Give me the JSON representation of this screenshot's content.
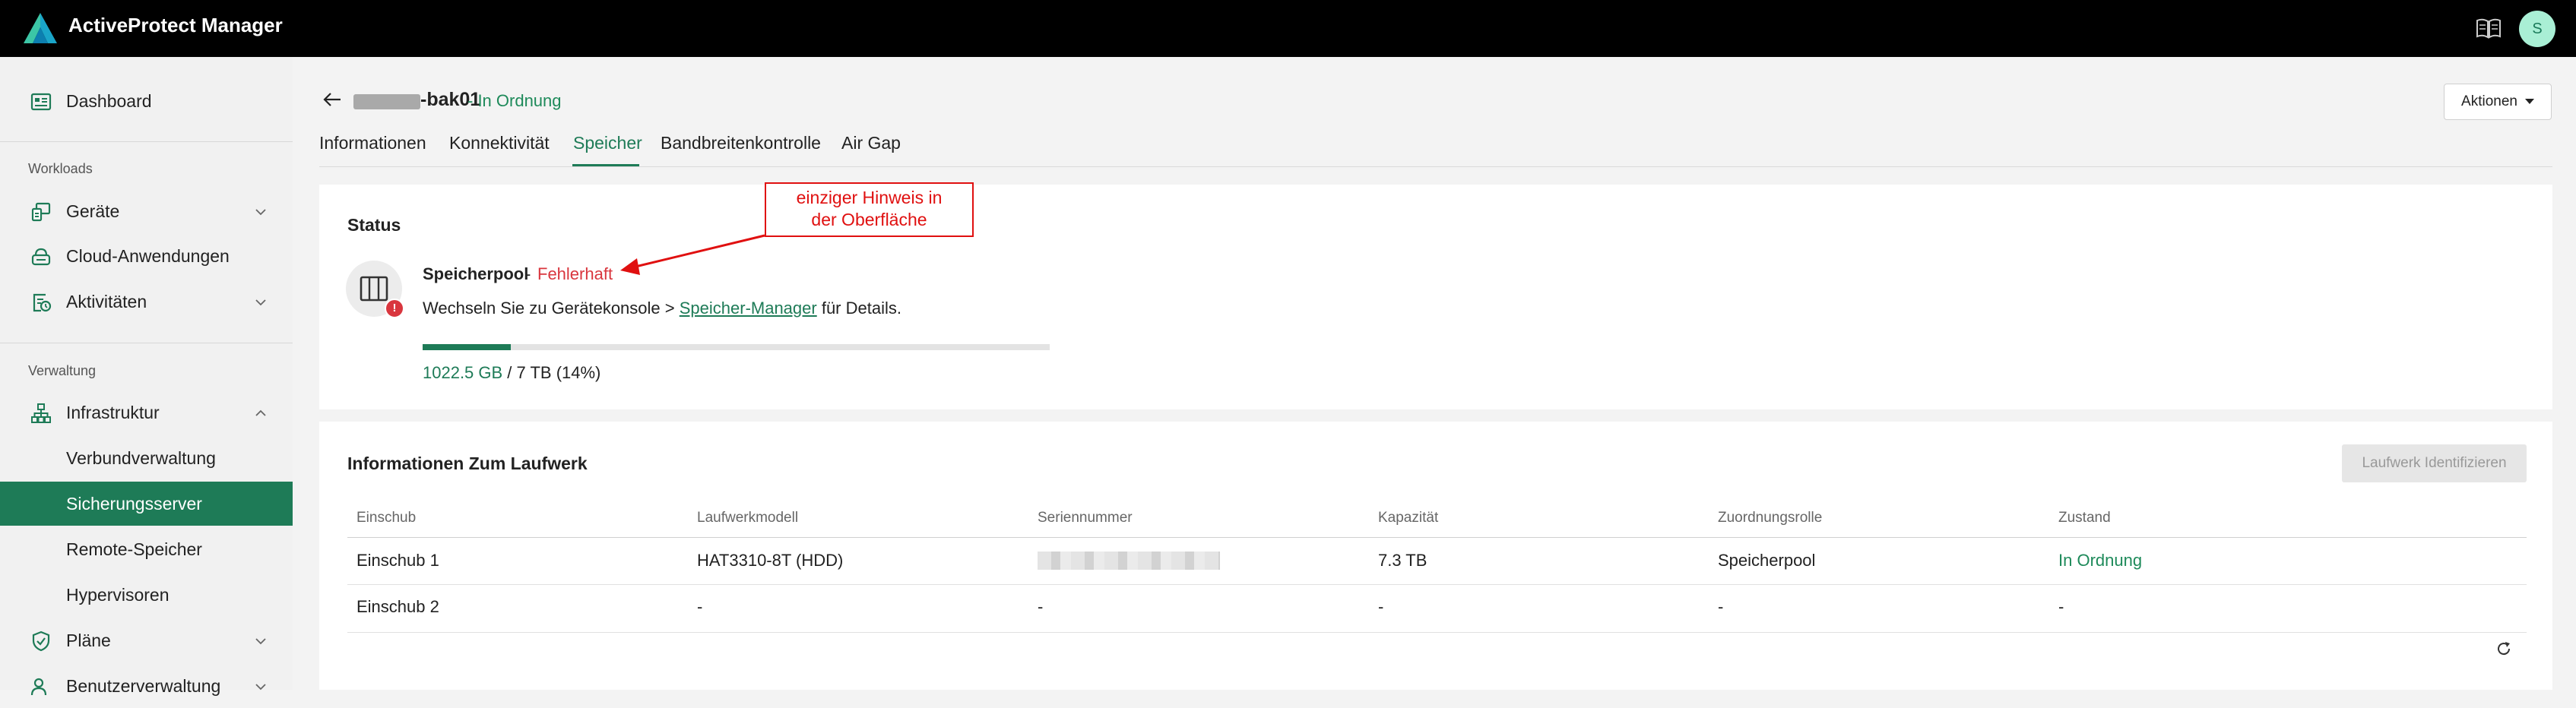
{
  "app": {
    "title": "ActiveProtect Manager",
    "avatar_initial": "S",
    "brand_color": "#1e7b57"
  },
  "sidebar": {
    "dashboard": "Dashboard",
    "section_workloads": "Workloads",
    "workloads": [
      "Geräte",
      "Cloud-Anwendungen",
      "Aktivitäten"
    ],
    "section_admin": "Verwaltung",
    "infrastructure": "Infrastruktur",
    "infrastructure_items": [
      "Verbundverwaltung",
      "Sicherungsserver",
      "Remote-Speicher",
      "Hypervisoren"
    ],
    "active_item": "Sicherungsserver",
    "plans": "Pläne",
    "users": "Benutzerverwaltung"
  },
  "header": {
    "device_name": "-bak01",
    "device_status": "- In Ordnung",
    "actions_label": "Aktionen"
  },
  "tabs": [
    "Informationen",
    "Konnektivität",
    "Speicher",
    "Bandbreitenkontrolle",
    "Air Gap"
  ],
  "active_tab": "Speicher",
  "status": {
    "title": "Status",
    "pool_label": "Speicherpool",
    "pool_separator": "-",
    "pool_state": "Fehlerhaft",
    "hint_prefix": "Wechseln Sie zu Gerätekonsole > ",
    "hint_link": "Speicher-Manager",
    "hint_suffix": " für Details.",
    "used": "1022.5 GB",
    "usage_rest": " / 7 TB (14%)",
    "usage_percent": 14
  },
  "annotation": {
    "line1": "einziger Hinweis in",
    "line2": "der Oberfläche",
    "color": "#e01010"
  },
  "drives": {
    "title": "Informationen Zum Laufwerk",
    "identify_button": "Laufwerk Identifizieren",
    "columns": [
      "Einschub",
      "Laufwerkmodell",
      "Seriennummer",
      "Kapazität",
      "Zuordnungsrolle",
      "Zustand"
    ],
    "rows": [
      {
        "slot": "Einschub 1",
        "model": "HAT3310-8T (HDD)",
        "serial": "",
        "capacity": "7.3 TB",
        "role": "Speicherpool",
        "state": "In Ordnung"
      },
      {
        "slot": "Einschub 2",
        "model": "-",
        "serial": "-",
        "capacity": "-",
        "role": "-",
        "state": "-"
      }
    ]
  }
}
